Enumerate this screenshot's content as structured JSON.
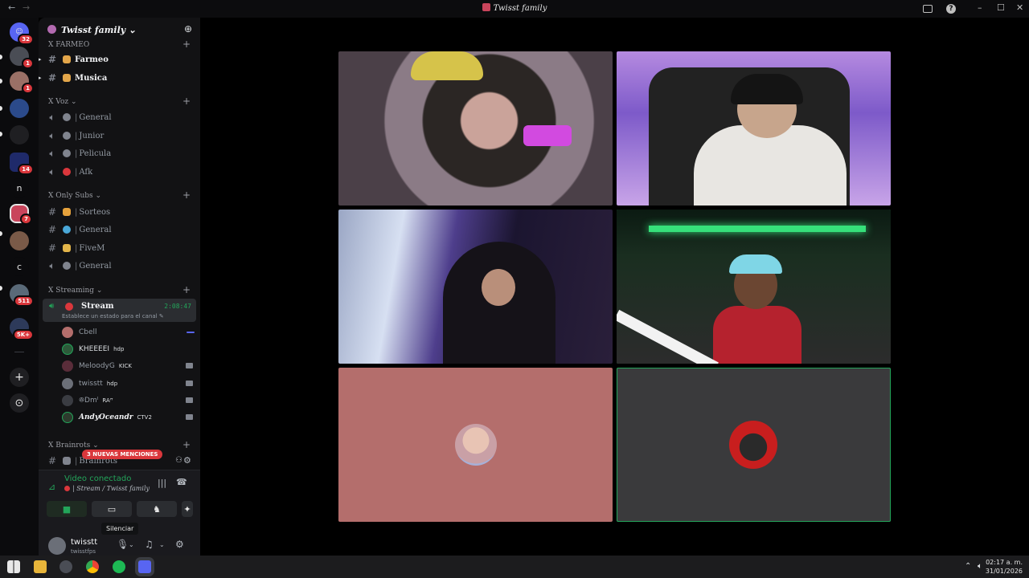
{
  "window": {
    "title": "Twisst family",
    "back_glyph": "←",
    "forward_glyph": "→",
    "inbox_icon": "inbox-icon",
    "help_glyph": "?",
    "minimize_glyph": "–",
    "maximize_glyph": "☐",
    "close_glyph": "✕"
  },
  "rail": {
    "servers": [
      {
        "label": "",
        "badge": "32"
      },
      {
        "label": "",
        "badge": "1"
      },
      {
        "label": "",
        "badge": "1"
      },
      {
        "label": "",
        "badge": ""
      },
      {
        "label": "",
        "badge": ""
      },
      {
        "label": "",
        "badge": "14"
      },
      {
        "label": "n",
        "badge": ""
      },
      {
        "label": "",
        "badge": "7"
      },
      {
        "label": "",
        "badge": ""
      },
      {
        "label": "c",
        "badge": ""
      },
      {
        "label": "",
        "badge": "511"
      },
      {
        "label": "",
        "badge": "5K+"
      }
    ],
    "add_glyph": "+",
    "discover_glyph": "⊙"
  },
  "server": {
    "name": "Twisst family",
    "chevron": "⌄",
    "invite_glyph": "⊕"
  },
  "categories": {
    "farmeo": "FARMEO",
    "voz": "Voz",
    "only_subs": "Only Subs",
    "streaming": "Streaming",
    "brainrots": "Brainrots",
    "prefix": "X"
  },
  "channels": {
    "farmeo": "Farmeo",
    "musica": "Musica",
    "voz_general": "General",
    "junior": "Junior",
    "pelicula": "Pelicula",
    "afk": "Afk",
    "sorteos": "Sorteos",
    "subs_general": "General",
    "fivem": "FiveM",
    "subs_general2": "General",
    "brainrots": "Brainrots"
  },
  "stream_channel": {
    "name": "Stream",
    "timer": "2:08:47",
    "status_placeholder": "Establece un estado para el canal"
  },
  "members": [
    {
      "name": "Cbell",
      "tag": ""
    },
    {
      "name": "KHEEEEI",
      "tag": "hdp"
    },
    {
      "name": "MeloodyG",
      "tag": "KICK"
    },
    {
      "name": "twisstt",
      "tag": "hdp"
    },
    {
      "name": "ꔮDmᴵ",
      "tag": "RAꟸ"
    },
    {
      "name": "AndyOceandr",
      "tag": "CTV2"
    }
  ],
  "mentions_pill": "3 NUEVAS MENCIONES",
  "voice": {
    "status": "Video conectado",
    "location": "Stream / Twisst family",
    "tooltip": "Silenciar"
  },
  "user": {
    "name": "twisstt",
    "handle": "twisstfps"
  },
  "taskbar": {
    "time": "02:17 a. m.",
    "date": "31/01/2026"
  },
  "colors": {
    "accent_green": "#23a55a",
    "danger_red": "#da373c",
    "brand_blurple": "#5865f2",
    "tile_pink_bg": "#b46e6c",
    "tile_grey_bg": "#3a3a3c"
  }
}
